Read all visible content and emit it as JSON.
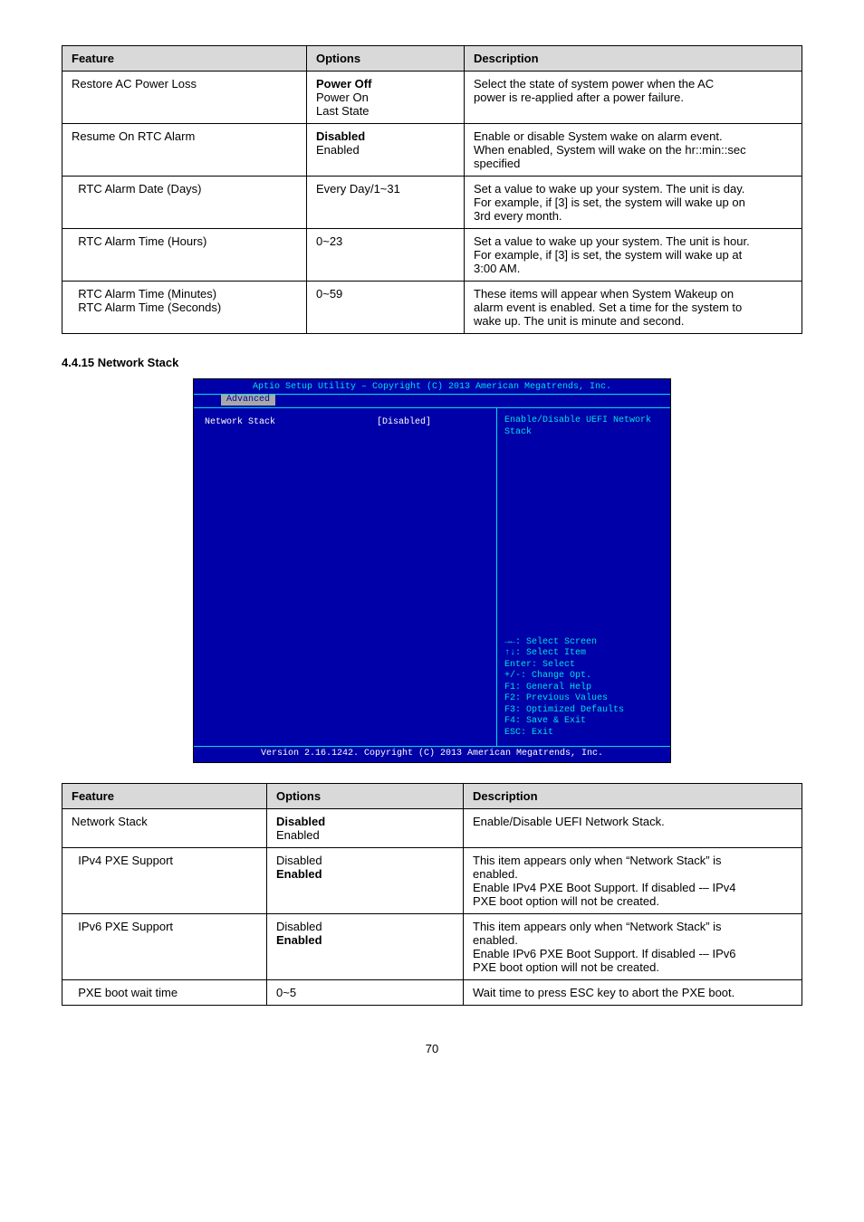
{
  "table1": {
    "head": {
      "feature": "Feature",
      "options": "Options",
      "description": "Description"
    },
    "rows": [
      {
        "feature": "Restore AC Power Loss",
        "options": [
          "Power Off",
          "Power On",
          "Last State"
        ],
        "desc": "Select the state of system power when the AC\npower is re-applied after a power failure."
      },
      {
        "feature": "Resume On RTC Alarm",
        "options": [
          "Disabled",
          "Enabled"
        ],
        "desc": "Enable or disable System wake on alarm event.\nWhen enabled, System will wake on the hr::min::sec\nspecified"
      },
      {
        "feature": "  RTC Alarm Date (Days)",
        "options": "Every Day/1~31",
        "desc": "Set a value to wake up your system. The unit is day.\nFor example, if [3] is set, the system will wake up on\n3rd every month."
      },
      {
        "feature": "  RTC Alarm Time (Hours)",
        "options": "0~23",
        "desc": "Set a value to wake up your system. The unit is hour.\nFor example, if [3] is set, the system will wake up at\n3:00 AM."
      },
      {
        "feature": "  RTC Alarm Time (Minutes)\n  RTC Alarm Time (Seconds)",
        "options": "0~59",
        "desc": "These items will appear when System Wakeup on\nalarm event is enabled. Set a time for the system to\nwake up. The unit is minute and second."
      }
    ]
  },
  "section_title": "4.4.15 Network Stack",
  "bios": {
    "title": "Aptio Setup Utility – Copyright (C) 2013 American Megatrends, Inc.",
    "tab": "Advanced",
    "setting_label": "Network Stack",
    "setting_value": "[Disabled]",
    "help": "Enable/Disable UEFI Network\nStack",
    "keys": [
      "→←: Select Screen",
      "↑↓: Select Item",
      "Enter: Select",
      "+/-: Change Opt.",
      "F1: General Help",
      "F2: Previous Values",
      "F3: Optimized Defaults",
      "F4: Save & Exit",
      "ESC: Exit"
    ],
    "footer": "Version 2.16.1242. Copyright (C) 2013 American Megatrends, Inc."
  },
  "table2": {
    "head": {
      "feature": "Feature",
      "options": "Options",
      "description": "Description"
    },
    "rows": [
      {
        "feature": "Network Stack",
        "options": [
          "Disabled",
          "Enabled"
        ],
        "desc": "Enable/Disable UEFI Network Stack."
      },
      {
        "feature": "  IPv4 PXE Support",
        "options": [
          "Disabled",
          "Enabled"
        ],
        "desc": "This item appears only when “Network Stack” is\nenabled.\nEnable IPv4 PXE Boot Support. If disabled -– IPv4\nPXE boot option will not be created."
      },
      {
        "feature": "  IPv6 PXE Support",
        "options": [
          "Disabled",
          "Enabled"
        ],
        "desc": "This item appears only when “Network Stack” is\nenabled.\nEnable IPv6 PXE Boot Support. If disabled -– IPv6\nPXE boot option will not be created."
      },
      {
        "feature": "  PXE boot wait time",
        "options": "0~5",
        "desc": "Wait time to press ESC key to abort the PXE boot."
      }
    ]
  },
  "page_num": "70"
}
